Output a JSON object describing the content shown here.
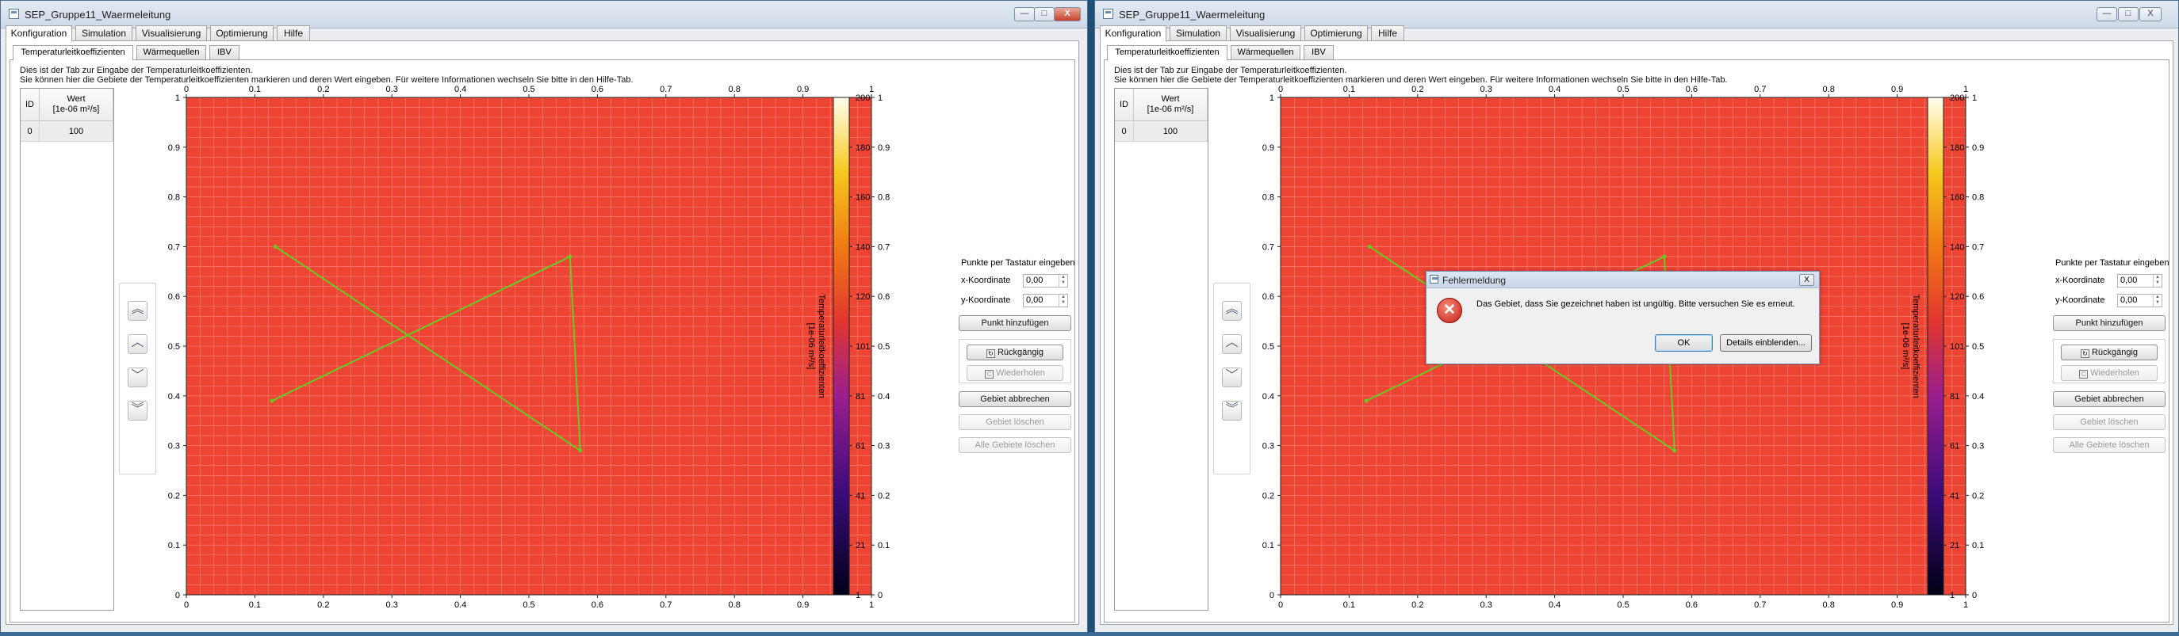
{
  "window": {
    "title": "SEP_Gruppe11_Waermeleitung",
    "controls": {
      "minimize": "—",
      "maximize": "□",
      "close": "X"
    }
  },
  "main_tabs": [
    "Konfiguration",
    "Simulation",
    "Visualisierung",
    "Optimierung",
    "Hilfe"
  ],
  "sub_tabs": [
    "Temperaturleitkoeffizienten",
    "Wärmequellen",
    "IBV"
  ],
  "description": {
    "line1": "Dies ist der Tab zur Eingabe der Temperaturleitkoeffizienten.",
    "line2": "Sie können hier die Gebiete der Temperaturleitkoeffizienten markieren und deren Wert eingeben. Für weitere Informationen wechseln Sie bitte in den Hilfe-Tab."
  },
  "table": {
    "headers": {
      "id": "ID",
      "value_line1": "Wert",
      "value_line2": "[1e-06 m²/s]"
    },
    "rows": [
      {
        "id": "0",
        "value": "100"
      }
    ]
  },
  "nav_icons": [
    "double-chevron-up-icon",
    "chevron-up-icon",
    "chevron-down-icon",
    "double-chevron-down-icon"
  ],
  "plot": {
    "fill_color": "#ee4433",
    "line_color": "#66cc22",
    "x_ticks": [
      "0",
      "0.1",
      "0.2",
      "0.3",
      "0.4",
      "0.5",
      "0.6",
      "0.7",
      "0.8",
      "0.9",
      "1"
    ],
    "y_ticks": [
      "0",
      "0.1",
      "0.2",
      "0.3",
      "0.4",
      "0.5",
      "0.6",
      "0.7",
      "0.8",
      "0.9",
      "1"
    ],
    "polygon_points": [
      [
        0.13,
        0.7
      ],
      [
        0.56,
        0.68
      ],
      [
        0.575,
        0.29
      ],
      [
        0.125,
        0.39
      ]
    ],
    "colorbar": {
      "ticks": [
        "1",
        "21",
        "41",
        "61",
        "81",
        "101",
        "120",
        "140",
        "160",
        "180",
        "200"
      ],
      "range": [
        1,
        200
      ],
      "label_line1": "Temperaturleitkoeffizienten",
      "label_line2": "[1e-06 m²/s]"
    }
  },
  "right_panel": {
    "title": "Punkte per Tastatur eingeben",
    "x_label": "x-Koordinate",
    "y_label": "y-Koordinate",
    "x_value": "0,00",
    "y_value": "0,00",
    "add_point": "Punkt hinzufügen",
    "undo": "Rückgängig",
    "redo": "Wiederholen",
    "cancel_area": "Gebiet abbrechen",
    "delete_area": "Gebiet löschen",
    "delete_all": "Alle Gebiete löschen"
  },
  "dialog": {
    "title": "Fehlermeldung",
    "message": "Das Gebiet, dass Sie gezeichnet haben ist ungültig. Bitte versuchen Sie es erneut.",
    "ok": "OK",
    "details": "Details einblenden...",
    "close": "X"
  }
}
